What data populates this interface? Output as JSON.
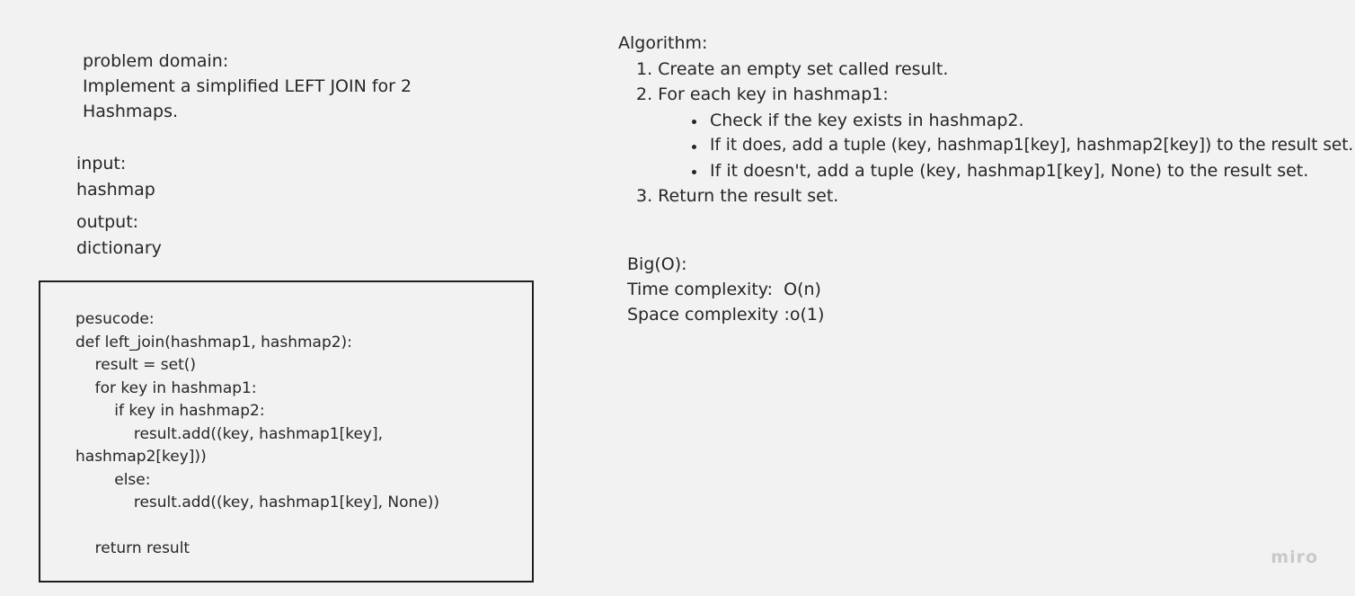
{
  "problem": {
    "line1": "problem domain:",
    "line2": "Implement a simplified LEFT JOIN for 2",
    "line3": "Hashmaps."
  },
  "input": {
    "label": "input:",
    "value": "hashmap"
  },
  "output": {
    "label": "output:",
    "value": "dictionary"
  },
  "pseudocode": {
    "lines": [
      "pesucode:",
      "def left_join(hashmap1, hashmap2):",
      "    result = set()",
      "    for key in hashmap1:",
      "        if key in hashmap2:",
      "            result.add((key, hashmap1[key],",
      "hashmap2[key]))",
      "        else:",
      "            result.add((key, hashmap1[key], None))",
      "",
      "    return result"
    ]
  },
  "algorithm": {
    "title": "Algorithm:",
    "step1": "1. Create an empty set called result.",
    "step2": "2. For each key in hashmap1:",
    "bullets": [
      "Check if the key exists in hashmap2.",
      "If it does, add a tuple (key, hashmap1[key], hashmap2[key]) to the result set.",
      "If it doesn't, add a tuple (key, hashmap1[key], None) to the result set."
    ],
    "step3": "3. Return the result set."
  },
  "complexity": {
    "title": "Big(O):",
    "time": "Time complexity:  O(n)",
    "space": "Space complexity :o(1)"
  },
  "watermark": "miro"
}
